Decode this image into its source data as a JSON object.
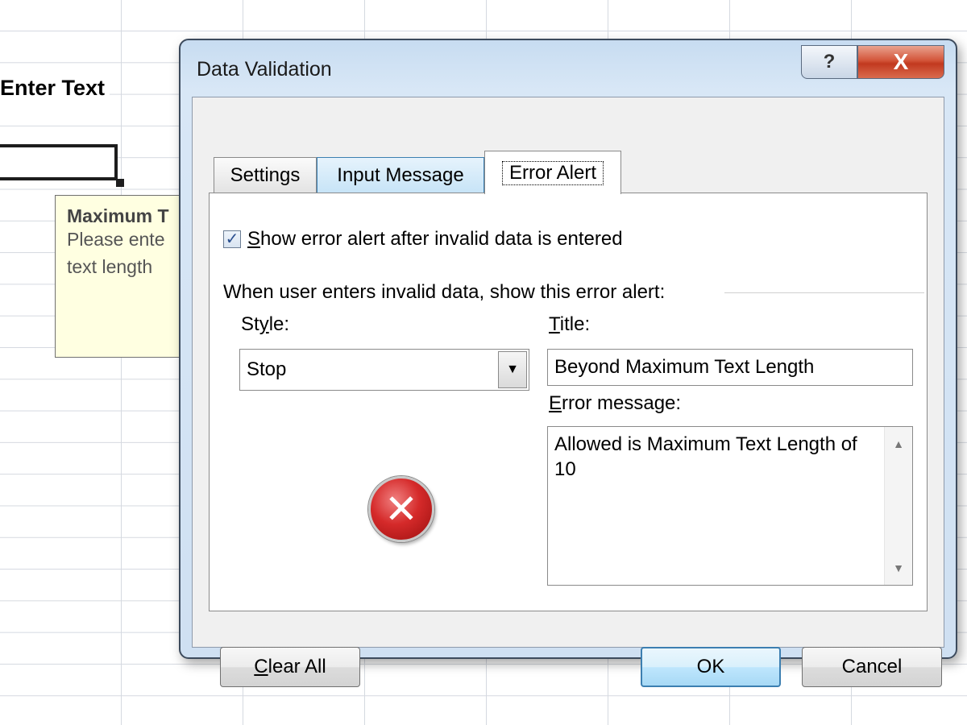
{
  "sheet": {
    "header_cell": "Enter Text",
    "input_tip": {
      "title": "Maximum T",
      "body": "Please ente\ntext length"
    }
  },
  "dialog": {
    "title": "Data Validation",
    "help_label": "?",
    "close_label": "X",
    "tabs": [
      {
        "label": "Settings"
      },
      {
        "label": "Input Message"
      },
      {
        "label": "Error Alert"
      }
    ],
    "show_alert": {
      "checked": true,
      "label_first": "S",
      "label_rest": "how error alert after invalid data is entered"
    },
    "group_label": "When user enters invalid data, show this error alert:",
    "style": {
      "label_a": "St",
      "label_u": "y",
      "label_b": "le:",
      "value": "Stop"
    },
    "title_field": {
      "label_u": "T",
      "label_rest": "itle:",
      "value": "Beyond Maximum Text Length"
    },
    "error_message": {
      "label_u": "E",
      "label_rest": "rror message:",
      "value": "Allowed is Maximum Text Length of 10"
    },
    "buttons": {
      "clear_u": "C",
      "clear_rest": "lear All",
      "ok": "OK",
      "cancel": "Cancel"
    },
    "accent_color": "#3c7fb1",
    "stop_icon_color": "#d52a2a"
  }
}
